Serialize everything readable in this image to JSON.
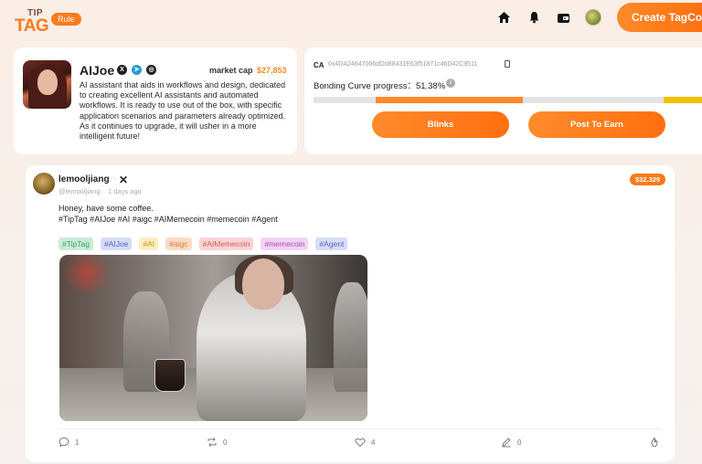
{
  "header": {
    "logo_top": "TIP",
    "logo_bottom": "TAG",
    "rule_label": "Rule",
    "create_button": "Create TagCoin",
    "icons": [
      "home-icon",
      "bell-icon",
      "wallet-icon",
      "user-avatar"
    ]
  },
  "profile": {
    "name": "AIJoe",
    "market_cap_label": "market cap",
    "market_cap_value": "$27,853",
    "socials": [
      "x-icon",
      "telegram-icon",
      "web-icon"
    ],
    "description": "AI assistant that aids in workflows and design, dedicated to creating excellent AI assistants and automated workflows. It is ready to use out of the box, with specific application scenarios and parameters already optimized. As it continues to upgrade, it will usher in a more intelligent future!"
  },
  "bonding": {
    "ca_label": "CA",
    "ca_value": "0x4DA24647066df2d88431E63f51871c46D42C9511",
    "progress_label": "Bonding Curve progress：51.38%",
    "progress": 0.5138,
    "blinks_button": "Blinks",
    "post_button": "Post To Earn"
  },
  "post": {
    "username": "lemooljiang",
    "handle": "@lemooljiang",
    "time": "1 days ago",
    "price": "$32.329",
    "line1": "Honey, have some coffee.",
    "line2": "#TipTag #AIJoe #AI #aigc #AIMemecoin #memecoin #Agent",
    "tags": [
      {
        "label": "#TipTag",
        "bg": "#c9ecd6",
        "color": "#3aa16a"
      },
      {
        "label": "#AIJoe",
        "bg": "#d7dcf7",
        "color": "#5563c9"
      },
      {
        "label": "#AI",
        "bg": "#fbefc1",
        "color": "#c99a10"
      },
      {
        "label": "#aigc",
        "bg": "#fadcc6",
        "color": "#d9783a"
      },
      {
        "label": "#AIMemecoin",
        "bg": "#f9d4d4",
        "color": "#d65a5a"
      },
      {
        "label": "#memecoin",
        "bg": "#f1d4f3",
        "color": "#b44cc0"
      },
      {
        "label": "#Agent",
        "bg": "#d8dcf7",
        "color": "#5a63c8"
      }
    ],
    "actions": {
      "comments": "1",
      "reposts": "0",
      "likes": "4",
      "edits": "0"
    }
  }
}
